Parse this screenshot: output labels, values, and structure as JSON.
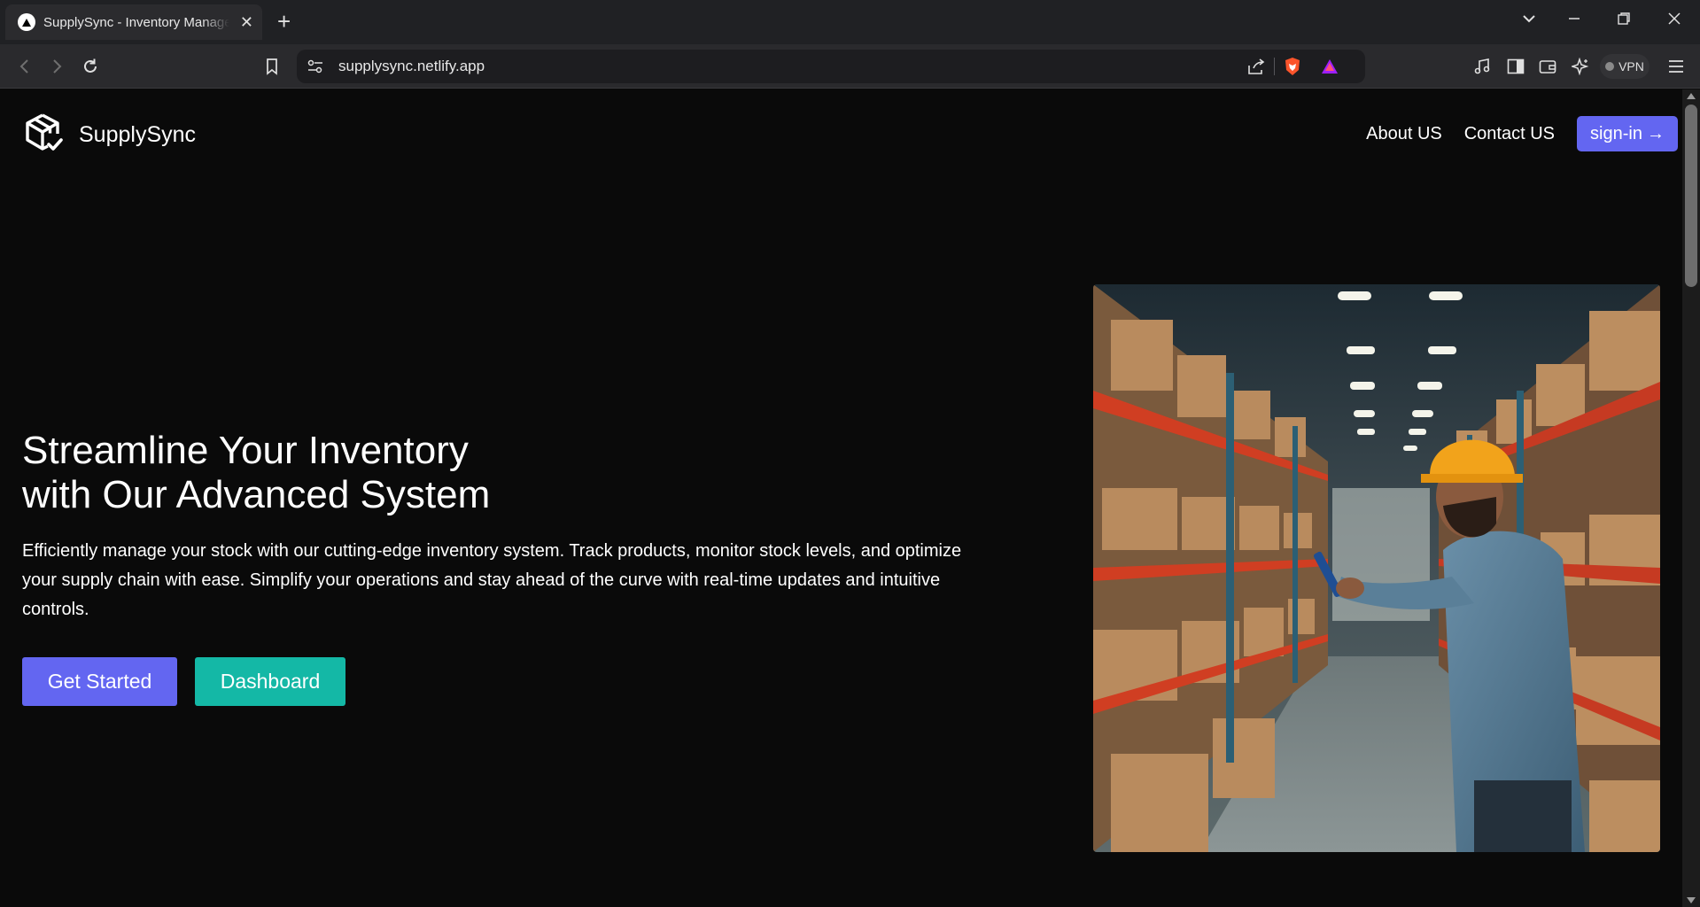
{
  "browser": {
    "tab_title": "SupplySync - Inventory Management",
    "tab_close": "✕",
    "new_tab": "+",
    "url": "supplysync.netlify.app",
    "vpn_label": "VPN"
  },
  "header": {
    "brand": "SupplySync",
    "nav": [
      "About US",
      "Contact US"
    ],
    "signin_label": "sign-in",
    "signin_arrow": "→"
  },
  "hero": {
    "title_line1": "Streamline Your Inventory",
    "title_line2": "with Our Advanced System",
    "description": "Efficiently manage your stock with our cutting-edge inventory system. Track products, monitor stock levels, and optimize your supply chain with ease. Simplify your operations and stay ahead of the curve with real-time updates and intuitive controls.",
    "primary_button": "Get Started",
    "secondary_button": "Dashboard",
    "image_icon": "warehouse-worker-photo"
  },
  "colors": {
    "accent": "#6366f1",
    "teal": "#14b8a6",
    "background": "#0a0a0a"
  },
  "icons": [
    "back-icon",
    "forward-icon",
    "reload-icon",
    "bookmark-icon",
    "site-settings-icon",
    "share-icon",
    "brave-shield-icon",
    "brave-rewards-icon",
    "music-icon",
    "sidebar-icon",
    "wallet-icon",
    "leo-ai-icon",
    "menu-icon",
    "package-logo-icon"
  ]
}
